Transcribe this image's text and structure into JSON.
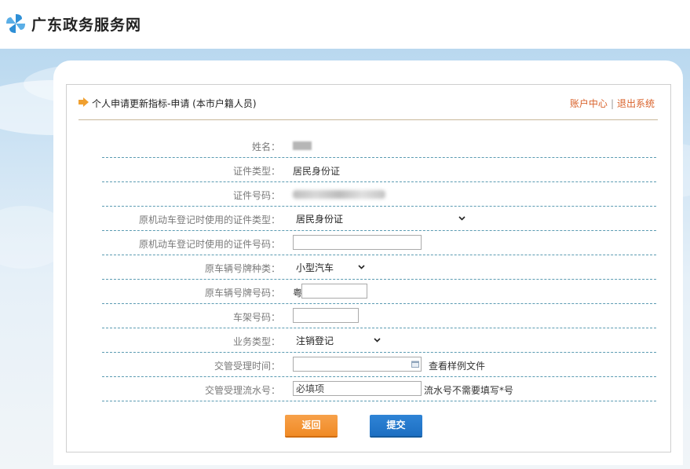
{
  "site": {
    "name": "广东政务服务网"
  },
  "page": {
    "title": "个人申请更新指标-申请 (本市户籍人员)",
    "links": {
      "account_center": "账户中心",
      "separator": "|",
      "logout": "退出系统"
    }
  },
  "form": {
    "name_label": "姓名：",
    "id_type_label": "证件类型：",
    "id_type_value": "居民身份证",
    "id_number_label": "证件号码：",
    "orig_id_type_label": "原机动车登记时使用的证件类型：",
    "orig_id_type_value": "居民身份证",
    "orig_id_number_label": "原机动车登记时使用的证件号码：",
    "plate_type_label": "原车辆号牌种类：",
    "plate_type_value": "小型汽车",
    "plate_number_label": "原车辆号牌号码：",
    "plate_prefix": "粤",
    "vin_label": "车架号码：",
    "business_type_label": "业务类型：",
    "business_type_value": "注销登记",
    "accept_time_label": "交管受理时间：",
    "view_sample": "查看样例文件",
    "serial_label": "交管受理流水号：",
    "serial_placeholder": "必填项",
    "serial_hint": "流水号不需要填写*号"
  },
  "buttons": {
    "back": "返回",
    "submit": "提交"
  },
  "colors": {
    "link": "#d9622b",
    "back_button": "#f08a25",
    "submit_button": "#1d6fc2",
    "row_divider": "#5b9bb2"
  },
  "icons": {
    "logo": "pinwheel-logo-icon",
    "title_arrow": "arrow-right-icon",
    "dropdown": "chevron-down-icon",
    "calendar": "calendar-icon"
  }
}
